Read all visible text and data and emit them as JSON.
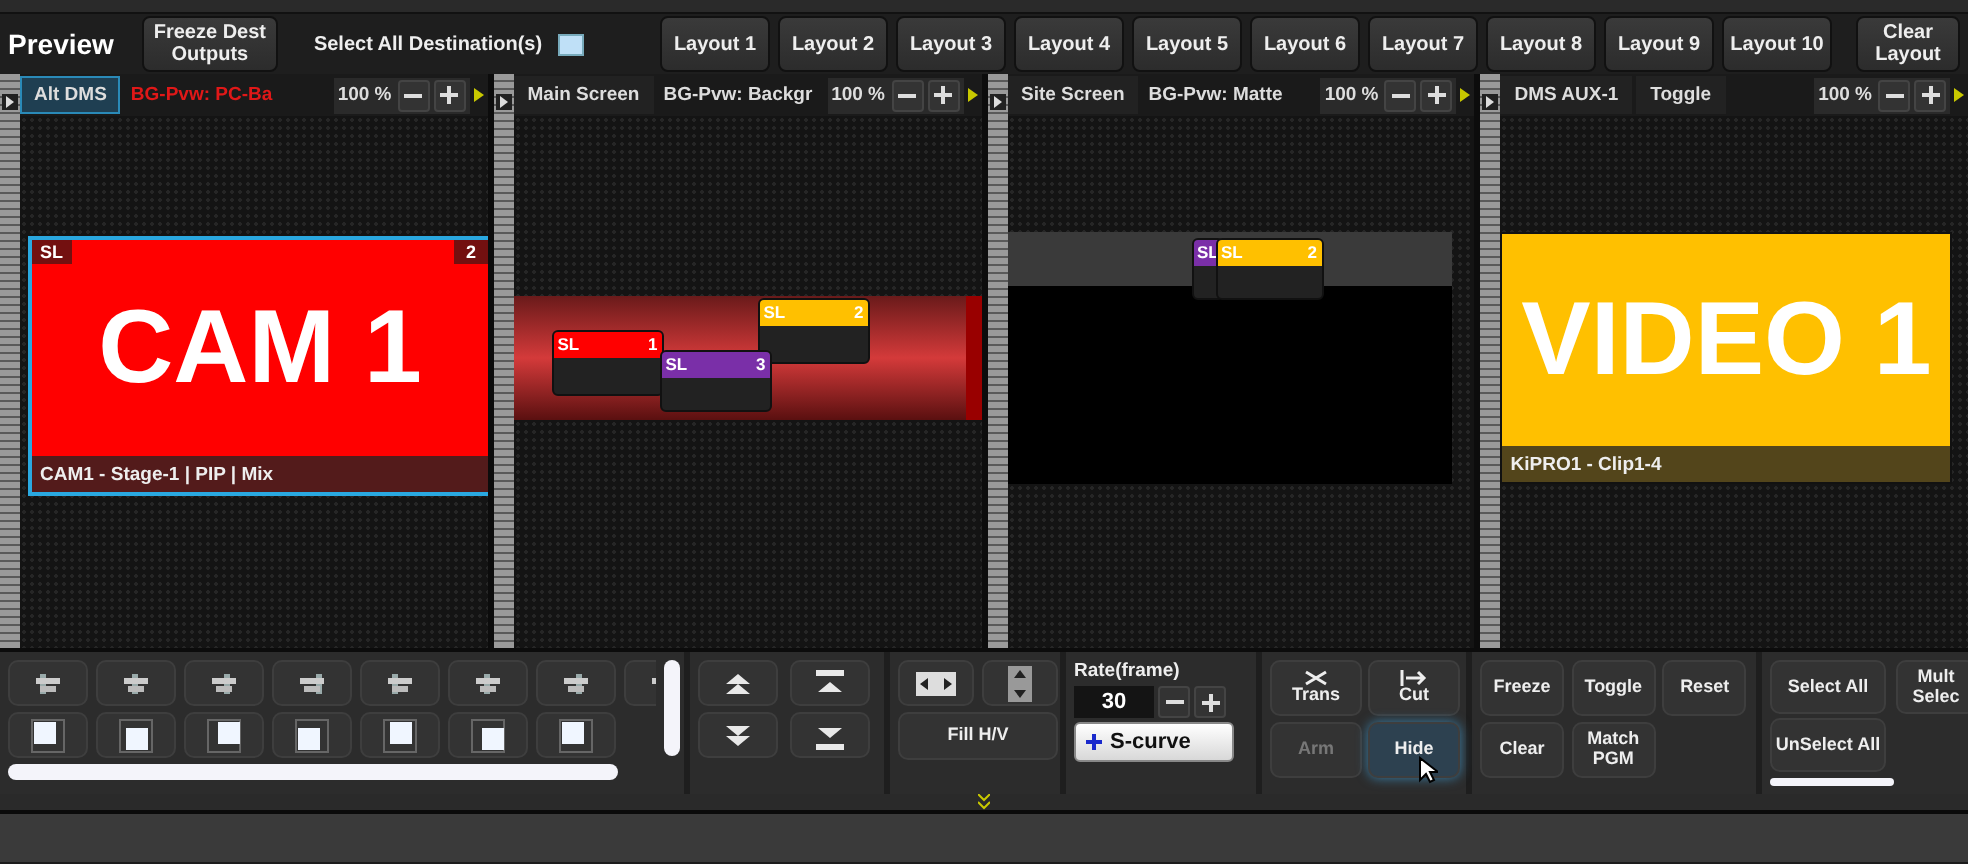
{
  "header": {
    "title": "Preview",
    "freeze_button": "Freeze Dest Outputs",
    "select_all": {
      "label": "Select All Destination(s)",
      "checked": false
    },
    "layouts": [
      "Layout 1",
      "Layout 2",
      "Layout 3",
      "Layout 4",
      "Layout 5",
      "Layout 6",
      "Layout 7",
      "Layout 8",
      "Layout 9",
      "Layout 10"
    ],
    "clear_button": "Clear Layout"
  },
  "panes": [
    {
      "tabs": [
        {
          "label": "Alt DMS",
          "selected": true
        }
      ],
      "background": "BG-Pvw: PC-Ba",
      "background_alert": true,
      "zoom": "100 %",
      "canvas": {
        "kind": "plain",
        "layers": [
          {
            "kind": "large",
            "tag": "SL",
            "number": "2",
            "label": "CAM 1",
            "caption": "CAM1 - Stage-1 | PIP | Mix",
            "color": "#ff0000",
            "selected": true
          }
        ]
      }
    },
    {
      "tabs": [
        {
          "label": "Main Screen",
          "selected": false
        }
      ],
      "background": "BG-Pvw: Backgr",
      "background_alert": false,
      "zoom": "100 %",
      "canvas": {
        "kind": "bar",
        "layers": [
          {
            "kind": "small",
            "tag": "SL",
            "number": "1",
            "color": "#ff0000",
            "selected": false
          },
          {
            "kind": "small",
            "tag": "SL",
            "number": "2",
            "color": "#ffc000",
            "selected": false
          },
          {
            "kind": "small",
            "tag": "SL",
            "number": "3",
            "color": "#7a2fa8",
            "selected": false
          }
        ]
      }
    },
    {
      "tabs": [
        {
          "label": "Site Screen",
          "selected": false
        }
      ],
      "background": "BG-Pvw: Matte",
      "background_alert": false,
      "zoom": "100 %",
      "canvas": {
        "kind": "matte",
        "layers": [
          {
            "kind": "small",
            "tag": "SL",
            "color": "#7a2fa8",
            "selected": false
          },
          {
            "kind": "small",
            "tag": "SL",
            "number": "2",
            "color": "#ffc000",
            "selected": false
          }
        ]
      }
    },
    {
      "tabs": [
        {
          "label": "DMS AUX-1",
          "selected": false
        },
        {
          "label": "Toggle",
          "selected": false
        }
      ],
      "zoom": "100 %",
      "canvas": {
        "kind": "plain",
        "layers": [
          {
            "kind": "large",
            "label": "VIDEO 1",
            "caption": "KiPRO1 - Clip1-4",
            "color": "#ffc000",
            "selected": false
          }
        ]
      }
    }
  ],
  "toolbar": {
    "fill_button": "Fill H/V",
    "rate": {
      "label": "Rate(frame)",
      "value": "30"
    },
    "curve_button": "S-curve",
    "transitions": [
      {
        "label": "Trans",
        "disabled": false,
        "hovered": false
      },
      {
        "label": "Cut",
        "disabled": false,
        "hovered": false
      },
      {
        "label": "Arm",
        "disabled": true,
        "hovered": false
      },
      {
        "label": "Hide",
        "disabled": false,
        "hovered": true
      }
    ],
    "actions": [
      "Freeze",
      "Toggle",
      "Reset",
      "Clear",
      "Match PGM"
    ],
    "select_buttons": [
      "Select All",
      "Mult Selec",
      "UnSelect All"
    ]
  }
}
